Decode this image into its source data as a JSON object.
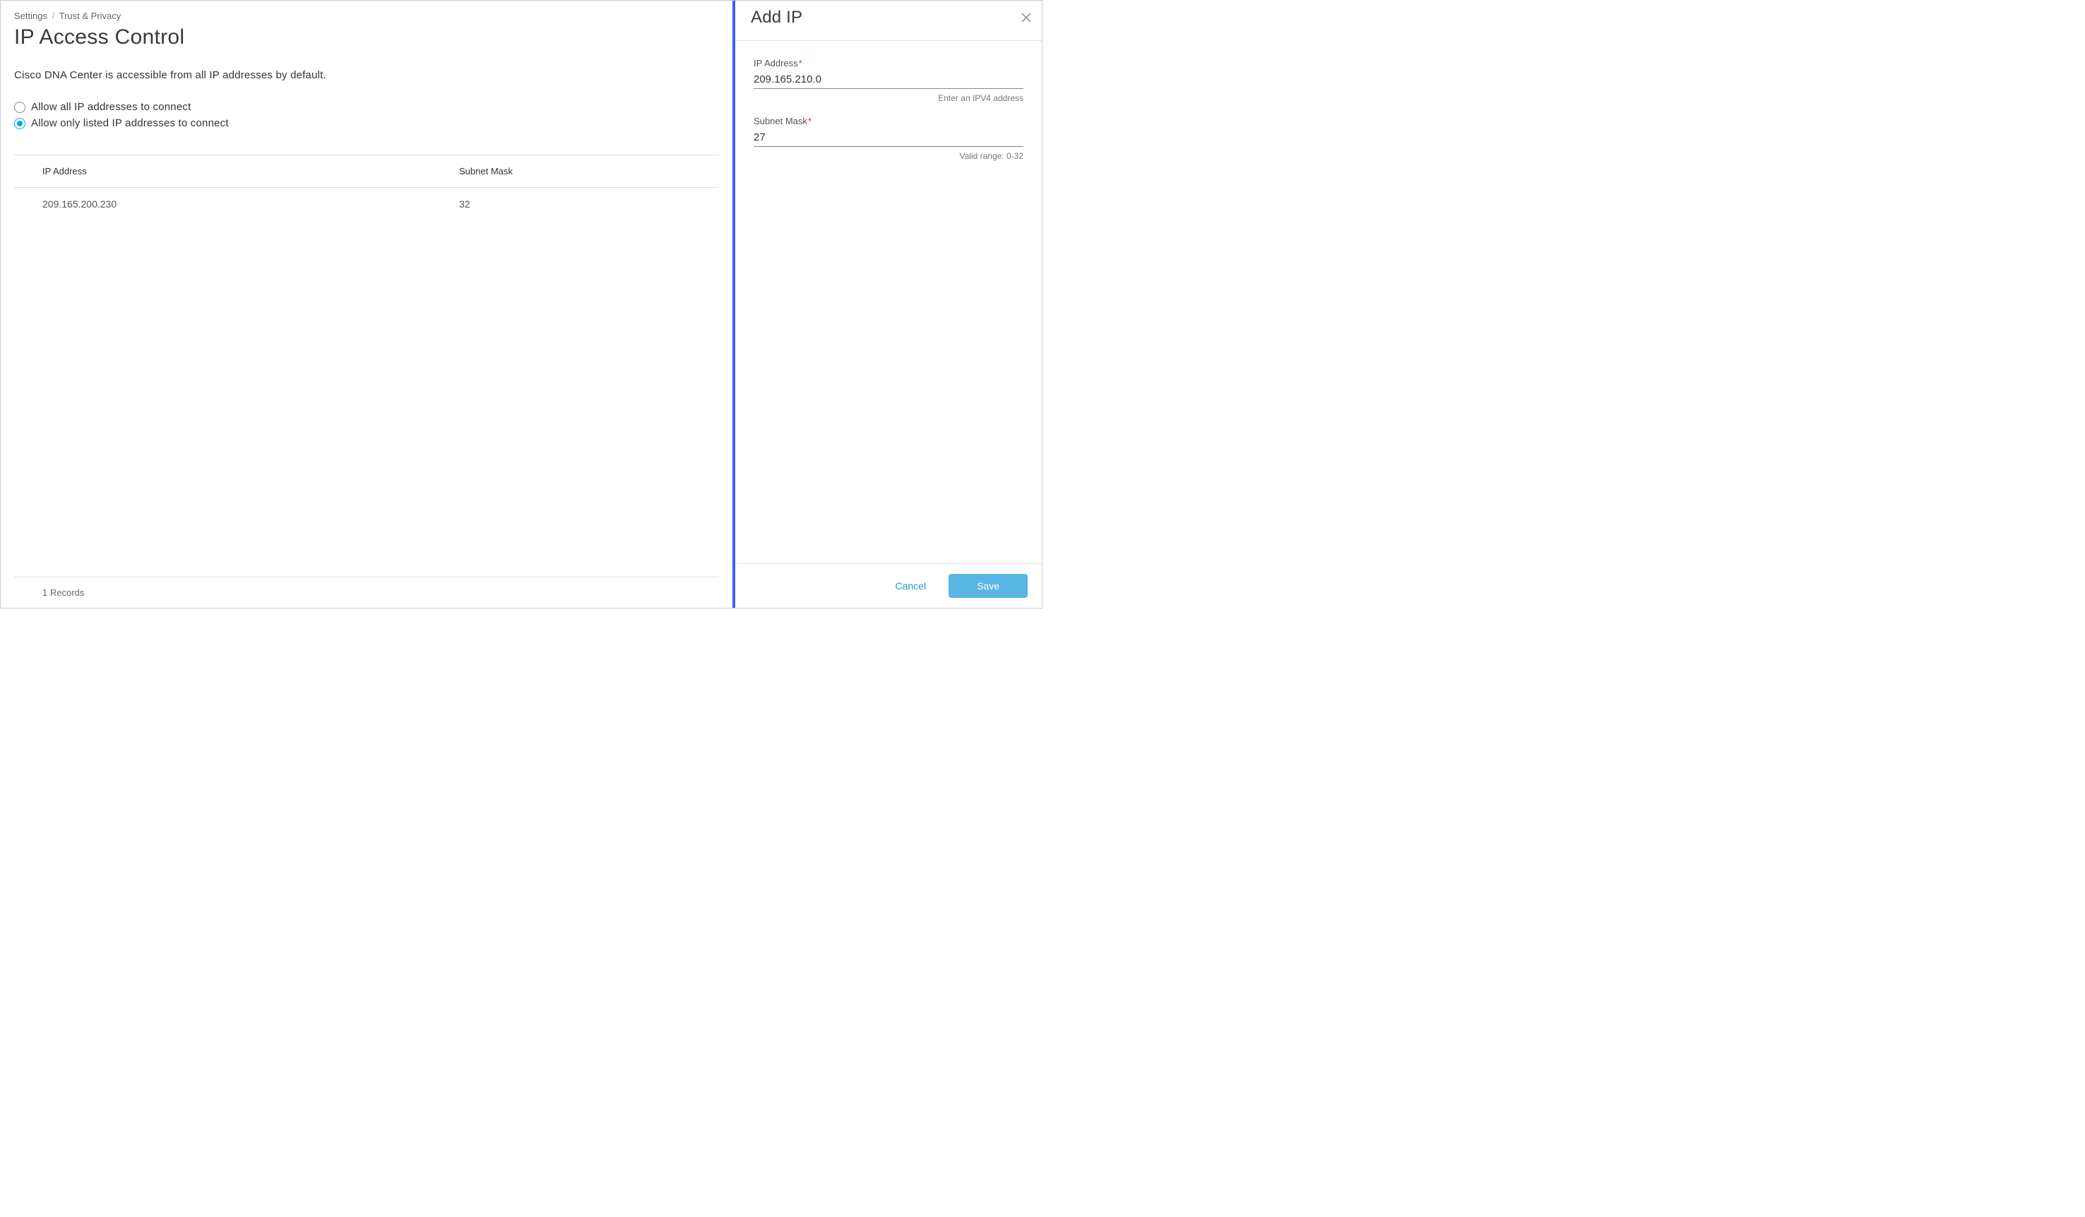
{
  "breadcrumb": {
    "items": [
      "Settings",
      "Trust & Privacy"
    ],
    "separator": "/"
  },
  "page": {
    "title": "IP Access Control",
    "description": "Cisco DNA Center is accessible from all IP addresses by default."
  },
  "radio_options": {
    "allow_all": "Allow all IP addresses to connect",
    "allow_listed": "Allow only listed IP addresses to connect",
    "selected": "allow_listed"
  },
  "table": {
    "headers": {
      "ip": "IP Address",
      "subnet": "Subnet Mask"
    },
    "rows": [
      {
        "ip": "209.165.200.230",
        "subnet": "32"
      }
    ],
    "footer": "1 Records"
  },
  "panel": {
    "title": "Add IP",
    "fields": {
      "ip_address": {
        "label": "IP Address",
        "value": "209.165.210.0",
        "hint": "Enter an IPV4 address"
      },
      "subnet_mask": {
        "label": "Subnet Mask",
        "value": "27",
        "hint": "Valid range: 0-32"
      }
    },
    "buttons": {
      "cancel": "Cancel",
      "save": "Save"
    }
  }
}
